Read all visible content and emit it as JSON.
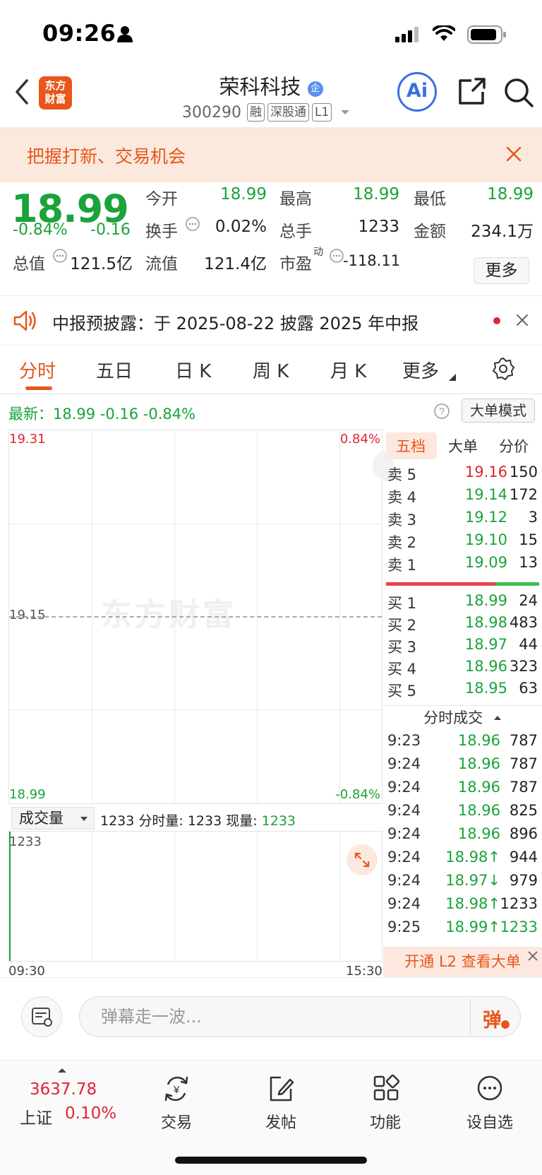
{
  "status_bar": {
    "time": "09:26"
  },
  "nav": {
    "logo_line1": "东方",
    "logo_line2": "财富",
    "stock_name": "荣科科技",
    "stock_code": "300290",
    "tags": [
      "融",
      "深股通",
      "L1"
    ],
    "ai_label": "Ai"
  },
  "promo": {
    "text": "把握打新、交易机会"
  },
  "quote": {
    "price": "18.99",
    "change_pct": "-0.84%",
    "change": "-0.16",
    "open_label": "今开",
    "open": "18.99",
    "high_label": "最高",
    "high": "18.99",
    "low_label": "最低",
    "low": "18.99",
    "turnover_label": "换手",
    "turnover": "0.02%",
    "volume_label": "总手",
    "volume": "1233",
    "amount_label": "金额",
    "amount": "234.1万",
    "mktcap_label": "总值",
    "mktcap": "121.5亿",
    "float_label": "流值",
    "float": "121.4亿",
    "pe_label": "市盈",
    "pe_sup": "动",
    "pe": "-118.11",
    "more_label": "更多"
  },
  "notice": {
    "text": "中报预披露：于 2025-08-22 披露 2025 年中报"
  },
  "tabs": [
    "分时",
    "五日",
    "日 K",
    "周 K",
    "月 K",
    "更多"
  ],
  "info_line": {
    "text": "最新：18.99  -0.16  -0.84%",
    "mode_button": "大单模式"
  },
  "chart": {
    "y_top": "19.31",
    "y_mid": "19.15",
    "y_bottom": "18.99",
    "pct_top": "0.84%",
    "pct_bottom": "-0.84%",
    "watermark": "东方财富",
    "x_start": "09:30",
    "x_end": "15:30"
  },
  "volume": {
    "selector": "成交量",
    "info_prefix": "1233 分时量: 1233 现量: ",
    "info_current": "1233",
    "axis_top": "1233"
  },
  "order_book": {
    "tabs": [
      "五档",
      "大单",
      "分价"
    ],
    "asks": [
      {
        "label": "卖 5",
        "price": "19.16",
        "volume": "150",
        "color": "#e02433"
      },
      {
        "label": "卖 4",
        "price": "19.14",
        "volume": "172",
        "color": "#1aa33a"
      },
      {
        "label": "卖 3",
        "price": "19.12",
        "volume": "3",
        "color": "#1aa33a"
      },
      {
        "label": "卖 2",
        "price": "19.10",
        "volume": "15",
        "color": "#1aa33a"
      },
      {
        "label": "卖 1",
        "price": "19.09",
        "volume": "13",
        "color": "#1aa33a"
      }
    ],
    "bids": [
      {
        "label": "买 1",
        "price": "18.99",
        "volume": "24"
      },
      {
        "label": "买 2",
        "price": "18.98",
        "volume": "483"
      },
      {
        "label": "买 3",
        "price": "18.97",
        "volume": "44"
      },
      {
        "label": "买 4",
        "price": "18.96",
        "volume": "323"
      },
      {
        "label": "买 5",
        "price": "18.95",
        "volume": "63"
      }
    ],
    "trades_header": "分时成交",
    "trades": [
      {
        "time": "9:23",
        "price": "18.96",
        "volume": "787",
        "vol_color": "#222"
      },
      {
        "time": "9:24",
        "price": "18.96",
        "volume": "787",
        "vol_color": "#222"
      },
      {
        "time": "9:24",
        "price": "18.96",
        "volume": "787",
        "vol_color": "#222"
      },
      {
        "time": "9:24",
        "price": "18.96",
        "volume": "825",
        "vol_color": "#222"
      },
      {
        "time": "9:24",
        "price": "18.96",
        "volume": "896",
        "vol_color": "#222"
      },
      {
        "time": "9:24",
        "price": "18.98↑",
        "volume": "944",
        "vol_color": "#222"
      },
      {
        "time": "9:24",
        "price": "18.97↓",
        "volume": "979",
        "vol_color": "#222"
      },
      {
        "time": "9:24",
        "price": "18.98↑",
        "volume": "1233",
        "vol_color": "#222"
      },
      {
        "time": "9:25",
        "price": "18.99↑",
        "volume": "1233",
        "vol_color": "#1aa33a"
      }
    ],
    "l2_banner": "开通 L2 查看大单"
  },
  "comment": {
    "placeholder": "弹幕走一波...",
    "danmu_label": "弹"
  },
  "bottom_nav": {
    "index_value": "3637.78",
    "index_name": "上证",
    "index_change": "0.10%",
    "items": [
      "交易",
      "发帖",
      "功能",
      "设自选"
    ]
  }
}
